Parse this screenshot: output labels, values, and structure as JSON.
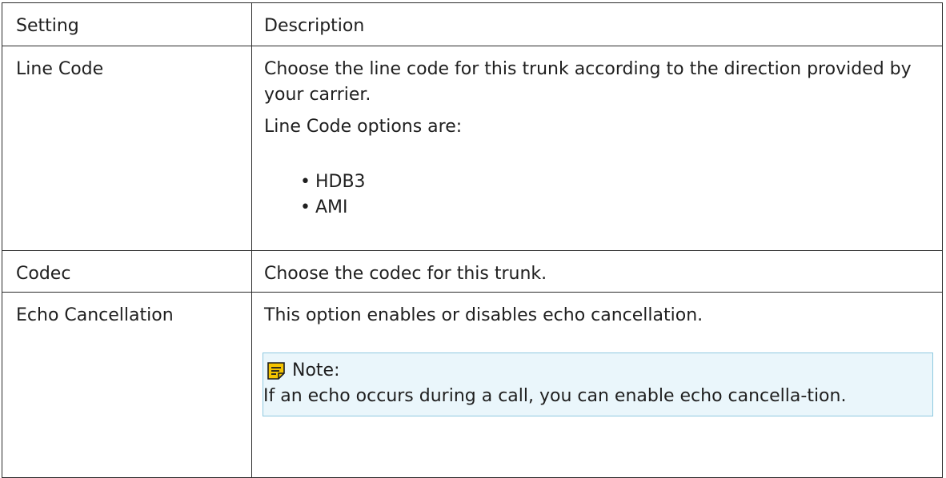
{
  "table": {
    "header": {
      "setting": "Setting",
      "description": "Description"
    },
    "rows": [
      {
        "setting": "Line Code",
        "paragraphs": [
          "Choose the line code for this trunk according to the direction provided by your carrier.",
          "Line Code options are:"
        ],
        "bullets": [
          "HDB3",
          "AMI"
        ]
      },
      {
        "setting": "Codec",
        "paragraphs": [
          "Choose the codec for this trunk."
        ]
      },
      {
        "setting": "Echo Cancellation",
        "paragraphs": [
          "This option enables or disables echo cancellation."
        ],
        "note": {
          "title": "Note:",
          "text": "If an echo occurs during a call, you can enable echo cancella-tion.",
          "icon": "note-icon",
          "icon_color": "#f5c400"
        }
      }
    ]
  },
  "colors": {
    "border": "#2b2b2b",
    "note_background": "#eaf6fb",
    "note_border": "#8fc9e0"
  }
}
